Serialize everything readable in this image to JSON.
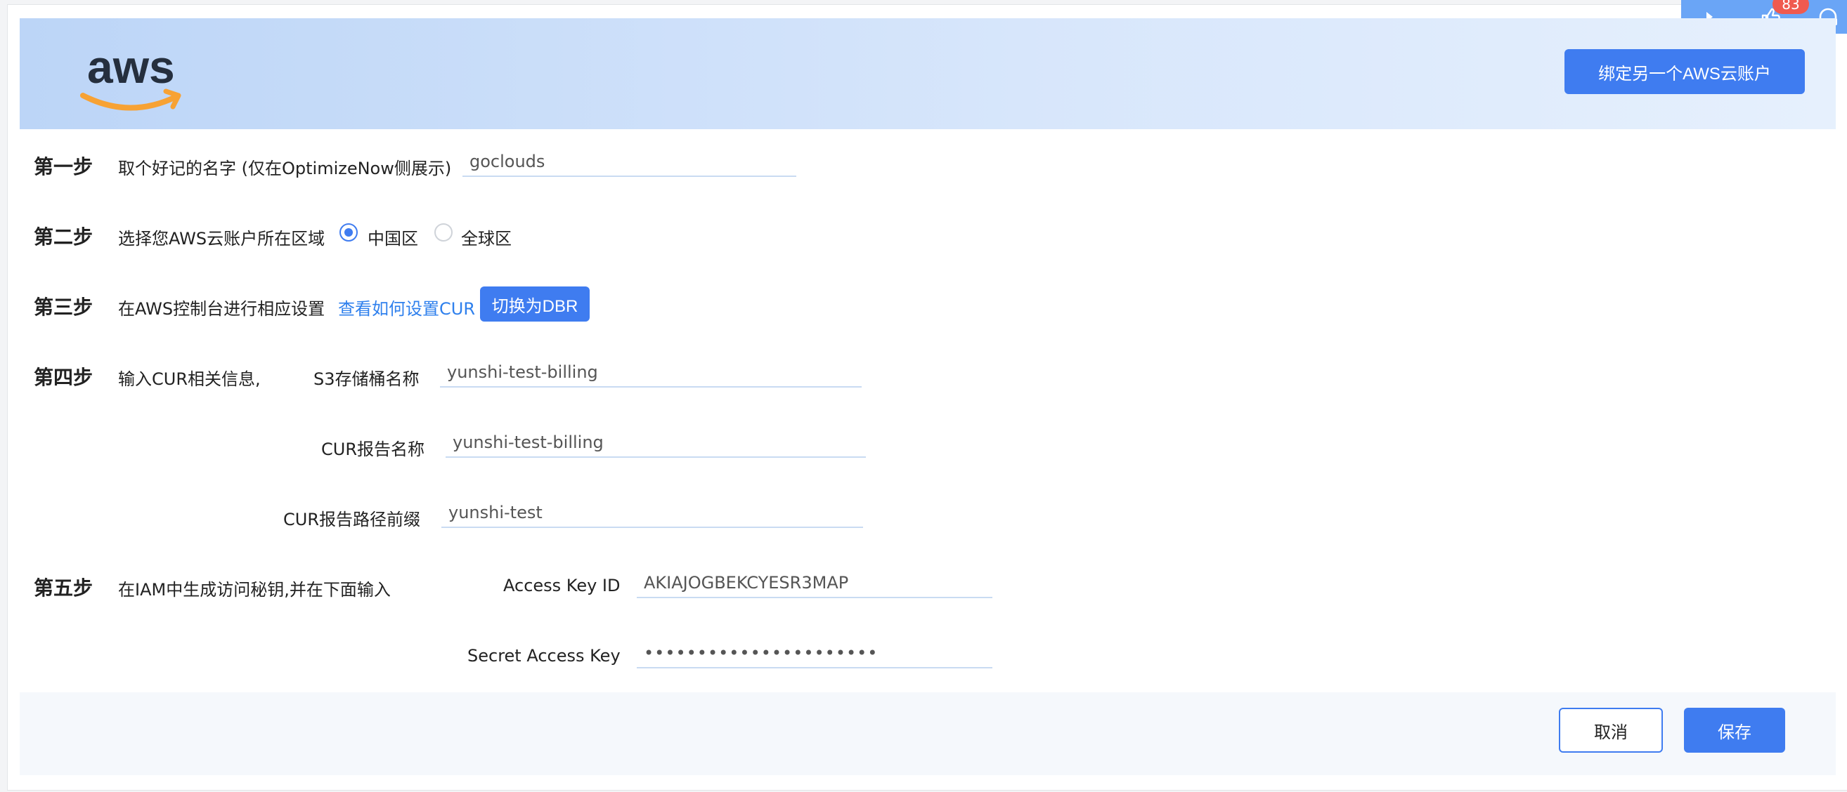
{
  "header": {
    "logo_text": "aws",
    "bind_button": "绑定另一个AWS云账户"
  },
  "float_bar": {
    "badge_count": "83",
    "icons": [
      "play-icon",
      "thumbs-up-icon",
      "headset-icon"
    ]
  },
  "steps": {
    "step1": {
      "label": "第一步",
      "description": "取个好记的名字 (仅在OptimizeNow侧展示)",
      "name_value": "goclouds"
    },
    "step2": {
      "label": "第二步",
      "description": "选择您AWS云账户所在区域",
      "options": [
        "中国区",
        "全球区"
      ],
      "selected": "中国区"
    },
    "step3": {
      "label": "第三步",
      "description": "在AWS控制台进行相应设置",
      "link": "查看如何设置CUR",
      "switch_button": "切换为DBR"
    },
    "step4": {
      "label": "第四步",
      "description": "输入CUR相关信息,",
      "bucket_label": "S3存储桶名称",
      "bucket_value": "yunshi-test-billing",
      "report_label": "CUR报告名称",
      "report_value": "yunshi-test-billing",
      "prefix_label": "CUR报告路径前缀",
      "prefix_value": "yunshi-test"
    },
    "step5": {
      "label": "第五步",
      "description": "在IAM中生成访问秘钥,并在下面输入",
      "key_id_label": "Access Key ID",
      "key_id_value": "AKIAJOGBEKCYESR3MAP",
      "secret_label": "Secret Access Key",
      "secret_value": "••••••••••••••••••••••"
    }
  },
  "footer": {
    "cancel": "取消",
    "save": "保存"
  },
  "colors": {
    "primary": "#3f7cf0",
    "link": "#2f80ed",
    "aws_orange": "#f7a234",
    "aws_dark": "#252f3e",
    "badge": "#f05a4f"
  }
}
